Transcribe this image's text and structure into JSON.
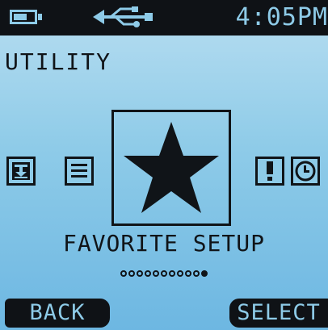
{
  "status_bar": {
    "battery_level": 0.66,
    "usb_icon": "usb-icon",
    "time": "4:05PM"
  },
  "title": "UTILITY",
  "carousel": {
    "items": [
      {
        "icon": "download-icon",
        "selected": false
      },
      {
        "icon": "list-icon",
        "selected": false
      },
      {
        "icon": "star-icon",
        "selected": true
      },
      {
        "icon": "alert-icon",
        "selected": false
      },
      {
        "icon": "clock-icon",
        "selected": false
      }
    ],
    "selected_label": "FAVORITE SETUP"
  },
  "pager": {
    "total": 11,
    "current": 11
  },
  "softkeys": {
    "left": "BACK",
    "right": "SELECT"
  },
  "colors": {
    "screen_top": "#b8def1",
    "screen_bottom": "#6db7e2",
    "bar": "#0f1216",
    "ink": "#101418",
    "bar_text": "#8ecbe8"
  }
}
